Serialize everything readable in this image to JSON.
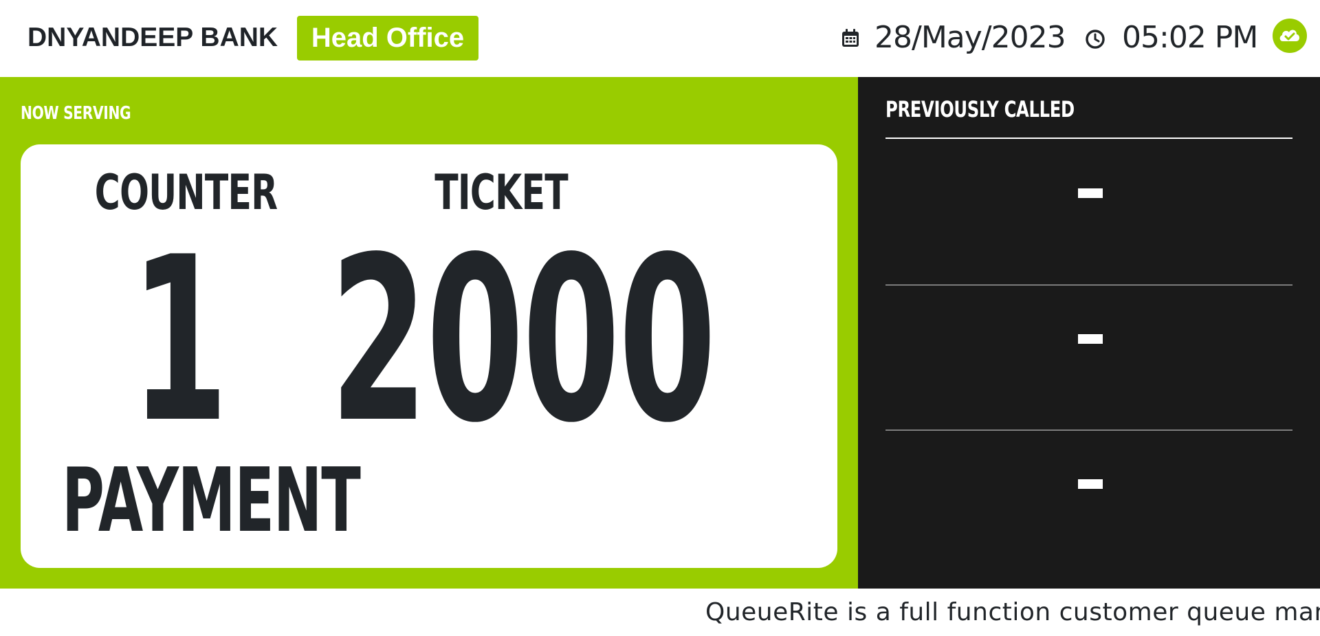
{
  "header": {
    "brand": "DNYANDEEP BANK",
    "branch": "Head Office",
    "date": "28/May/2023",
    "time": "05:02 PM",
    "icons": {
      "calendar": "calendar-icon",
      "clock": "clock-icon",
      "status": "cloud-check-icon"
    },
    "colors": {
      "accent": "#99cc00",
      "text": "#212529"
    }
  },
  "now_serving": {
    "label": "NOW SERVING",
    "counter_label": "COUNTER",
    "ticket_label": "TICKET",
    "counter": "1",
    "ticket": "2000",
    "service": "PAYMENT",
    "colors": {
      "panel": "#99cc00",
      "card": "#ffffff"
    }
  },
  "previously_called": {
    "label": "PREVIOUSLY CALLED",
    "items": [
      "-",
      "-",
      "-"
    ],
    "colors": {
      "panel": "#1a1a1a"
    }
  },
  "ticker": {
    "text": "QueueRite is a full function customer queue manage"
  }
}
